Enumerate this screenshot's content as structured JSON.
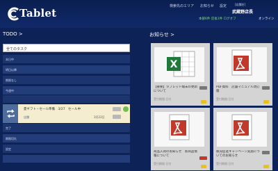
{
  "header": {
    "app_title": "Tablet",
    "links": [
      "検索先のエリア",
      "お知らせ",
      "設定"
    ],
    "shop_label": "[店舗名]",
    "shop_name": "武蔵野店長",
    "sub_green": "本部6件 店長1件 ログオフ",
    "online": "オンライン"
  },
  "todo": {
    "title": "TODO >",
    "input_value": "全てのタスク",
    "rows_top": [
      "本日中",
      "明日以降",
      "期限なし",
      "今週中"
    ],
    "rows_bottom": [
      "完了",
      "期限切れ",
      "設定"
    ],
    "card": {
      "title": "夏ギフト・セール準備　3/27　セール中",
      "location": "店舗",
      "date": "3月22日"
    }
  },
  "notices": {
    "title": "お知らせ >",
    "items": [
      {
        "icon": "excel-icon",
        "title": "【重要】タブレット端末の更新について",
        "date": "受付期限:日付"
      },
      {
        "icon": "pdf-icon",
        "title": "PDF資料　店舗マニュアル改訂版",
        "date": "受付期限:日付"
      },
      {
        "icon": "pdf-icon",
        "title": "商品入荷のお知らせ　新商品情報について",
        "date": "受付期限:日付"
      },
      {
        "icon": "pdf-icon",
        "title": "販売促進キャンペーン実施についてのお知らせ",
        "date": "受付期限:日付"
      }
    ]
  },
  "colors": {
    "background": "#0d2358",
    "accent_green": "#7fe07a"
  }
}
